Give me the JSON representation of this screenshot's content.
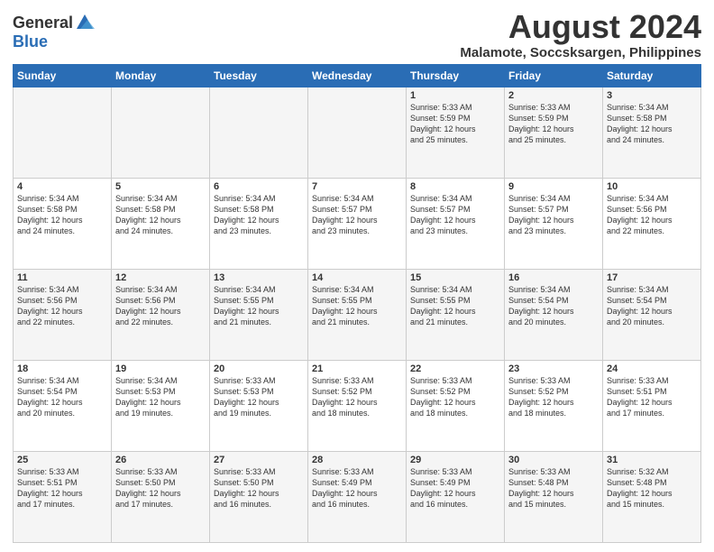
{
  "logo": {
    "general": "General",
    "blue": "Blue"
  },
  "title": "August 2024",
  "subtitle": "Malamote, Soccsksargen, Philippines",
  "days": [
    "Sunday",
    "Monday",
    "Tuesday",
    "Wednesday",
    "Thursday",
    "Friday",
    "Saturday"
  ],
  "weeks": [
    [
      {
        "day": "",
        "info": ""
      },
      {
        "day": "",
        "info": ""
      },
      {
        "day": "",
        "info": ""
      },
      {
        "day": "",
        "info": ""
      },
      {
        "day": "1",
        "info": "Sunrise: 5:33 AM\nSunset: 5:59 PM\nDaylight: 12 hours\nand 25 minutes."
      },
      {
        "day": "2",
        "info": "Sunrise: 5:33 AM\nSunset: 5:59 PM\nDaylight: 12 hours\nand 25 minutes."
      },
      {
        "day": "3",
        "info": "Sunrise: 5:34 AM\nSunset: 5:58 PM\nDaylight: 12 hours\nand 24 minutes."
      }
    ],
    [
      {
        "day": "4",
        "info": "Sunrise: 5:34 AM\nSunset: 5:58 PM\nDaylight: 12 hours\nand 24 minutes."
      },
      {
        "day": "5",
        "info": "Sunrise: 5:34 AM\nSunset: 5:58 PM\nDaylight: 12 hours\nand 24 minutes."
      },
      {
        "day": "6",
        "info": "Sunrise: 5:34 AM\nSunset: 5:58 PM\nDaylight: 12 hours\nand 23 minutes."
      },
      {
        "day": "7",
        "info": "Sunrise: 5:34 AM\nSunset: 5:57 PM\nDaylight: 12 hours\nand 23 minutes."
      },
      {
        "day": "8",
        "info": "Sunrise: 5:34 AM\nSunset: 5:57 PM\nDaylight: 12 hours\nand 23 minutes."
      },
      {
        "day": "9",
        "info": "Sunrise: 5:34 AM\nSunset: 5:57 PM\nDaylight: 12 hours\nand 23 minutes."
      },
      {
        "day": "10",
        "info": "Sunrise: 5:34 AM\nSunset: 5:56 PM\nDaylight: 12 hours\nand 22 minutes."
      }
    ],
    [
      {
        "day": "11",
        "info": "Sunrise: 5:34 AM\nSunset: 5:56 PM\nDaylight: 12 hours\nand 22 minutes."
      },
      {
        "day": "12",
        "info": "Sunrise: 5:34 AM\nSunset: 5:56 PM\nDaylight: 12 hours\nand 22 minutes."
      },
      {
        "day": "13",
        "info": "Sunrise: 5:34 AM\nSunset: 5:55 PM\nDaylight: 12 hours\nand 21 minutes."
      },
      {
        "day": "14",
        "info": "Sunrise: 5:34 AM\nSunset: 5:55 PM\nDaylight: 12 hours\nand 21 minutes."
      },
      {
        "day": "15",
        "info": "Sunrise: 5:34 AM\nSunset: 5:55 PM\nDaylight: 12 hours\nand 21 minutes."
      },
      {
        "day": "16",
        "info": "Sunrise: 5:34 AM\nSunset: 5:54 PM\nDaylight: 12 hours\nand 20 minutes."
      },
      {
        "day": "17",
        "info": "Sunrise: 5:34 AM\nSunset: 5:54 PM\nDaylight: 12 hours\nand 20 minutes."
      }
    ],
    [
      {
        "day": "18",
        "info": "Sunrise: 5:34 AM\nSunset: 5:54 PM\nDaylight: 12 hours\nand 20 minutes."
      },
      {
        "day": "19",
        "info": "Sunrise: 5:34 AM\nSunset: 5:53 PM\nDaylight: 12 hours\nand 19 minutes."
      },
      {
        "day": "20",
        "info": "Sunrise: 5:33 AM\nSunset: 5:53 PM\nDaylight: 12 hours\nand 19 minutes."
      },
      {
        "day": "21",
        "info": "Sunrise: 5:33 AM\nSunset: 5:52 PM\nDaylight: 12 hours\nand 18 minutes."
      },
      {
        "day": "22",
        "info": "Sunrise: 5:33 AM\nSunset: 5:52 PM\nDaylight: 12 hours\nand 18 minutes."
      },
      {
        "day": "23",
        "info": "Sunrise: 5:33 AM\nSunset: 5:52 PM\nDaylight: 12 hours\nand 18 minutes."
      },
      {
        "day": "24",
        "info": "Sunrise: 5:33 AM\nSunset: 5:51 PM\nDaylight: 12 hours\nand 17 minutes."
      }
    ],
    [
      {
        "day": "25",
        "info": "Sunrise: 5:33 AM\nSunset: 5:51 PM\nDaylight: 12 hours\nand 17 minutes."
      },
      {
        "day": "26",
        "info": "Sunrise: 5:33 AM\nSunset: 5:50 PM\nDaylight: 12 hours\nand 17 minutes."
      },
      {
        "day": "27",
        "info": "Sunrise: 5:33 AM\nSunset: 5:50 PM\nDaylight: 12 hours\nand 16 minutes."
      },
      {
        "day": "28",
        "info": "Sunrise: 5:33 AM\nSunset: 5:49 PM\nDaylight: 12 hours\nand 16 minutes."
      },
      {
        "day": "29",
        "info": "Sunrise: 5:33 AM\nSunset: 5:49 PM\nDaylight: 12 hours\nand 16 minutes."
      },
      {
        "day": "30",
        "info": "Sunrise: 5:33 AM\nSunset: 5:48 PM\nDaylight: 12 hours\nand 15 minutes."
      },
      {
        "day": "31",
        "info": "Sunrise: 5:32 AM\nSunset: 5:48 PM\nDaylight: 12 hours\nand 15 minutes."
      }
    ]
  ]
}
